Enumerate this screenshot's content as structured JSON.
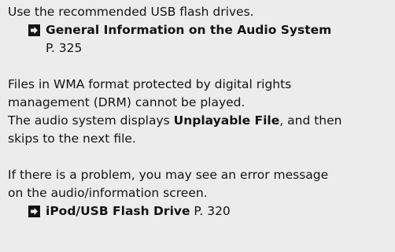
{
  "intro": {
    "text": "Use the recommended USB flash drives."
  },
  "xref1": {
    "icon": "arrow-icon",
    "title": "General Information on the Audio System",
    "page": "P. 325"
  },
  "drm": {
    "line1": "Files in WMA format protected by digital rights",
    "line2": "management (DRM) cannot be played.",
    "line3_pre": "The audio system displays ",
    "line3_bold": "Unplayable File",
    "line3_post": ", and then",
    "line4": "skips to the next file."
  },
  "problem": {
    "line1": "If there is a problem, you may see an error message",
    "line2": "on the audio/information screen."
  },
  "xref2": {
    "icon": "arrow-icon",
    "title": "iPod/USB Flash Drive",
    "page": " P. 320"
  }
}
